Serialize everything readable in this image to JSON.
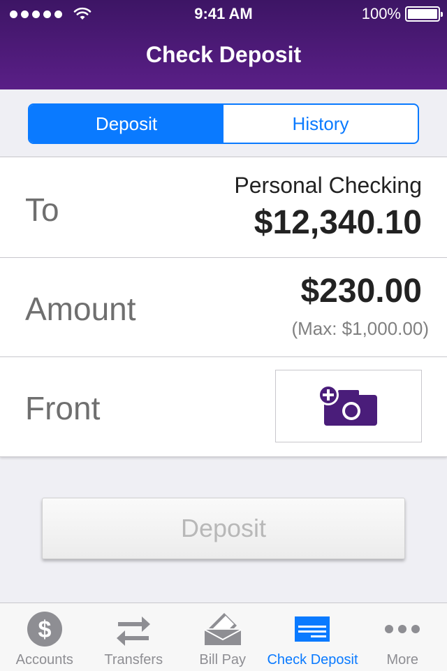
{
  "status_bar": {
    "time": "9:41 AM",
    "battery": "100%"
  },
  "header": {
    "title": "Check Deposit"
  },
  "segmented": {
    "options": [
      {
        "label": "Deposit",
        "selected": true
      },
      {
        "label": "History",
        "selected": false
      }
    ]
  },
  "form": {
    "to": {
      "label": "To",
      "account": "Personal Checking",
      "balance": "$12,340.10"
    },
    "amount": {
      "label": "Amount",
      "value": "$230.00",
      "max": "(Max: $1,000.00)"
    },
    "front": {
      "label": "Front",
      "icon": "add-photo-camera-icon"
    }
  },
  "deposit_button": {
    "label": "Deposit",
    "enabled": false
  },
  "tabbar": {
    "items": [
      {
        "label": "Accounts",
        "icon": "dollar-circle-icon",
        "active": false
      },
      {
        "label": "Transfers",
        "icon": "transfer-arrows-icon",
        "active": false
      },
      {
        "label": "Bill Pay",
        "icon": "bill-pay-icon",
        "active": false
      },
      {
        "label": "Check Deposit",
        "icon": "check-deposit-icon",
        "active": true
      },
      {
        "label": "More",
        "icon": "more-dots-icon",
        "active": false
      }
    ]
  },
  "colors": {
    "brand_purple": "#4b1a78",
    "accent_blue": "#0a7aff",
    "camera_purple": "#4a1d7a"
  }
}
